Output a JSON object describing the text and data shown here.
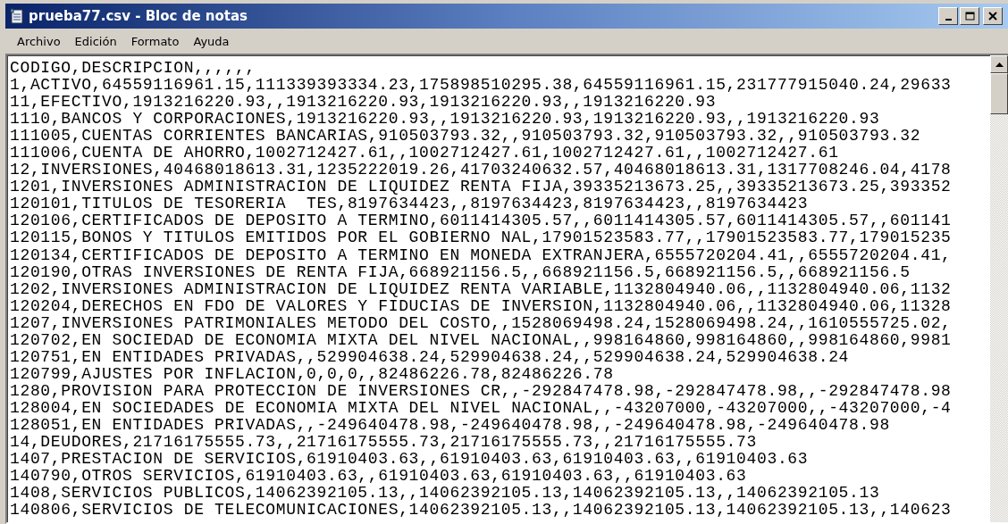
{
  "window": {
    "title": "prueba77.csv - Bloc de notas"
  },
  "menu": [
    "Archivo",
    "Edición",
    "Formato",
    "Ayuda"
  ],
  "lines": [
    "CODIGO,DESCRIPCION,,,,,,",
    "1,ACTIVO,64559116961.15,111339393334.23,175898510295.38,64559116961.15,231777915040.24,29633",
    "11,EFECTIVO,1913216220.93,,1913216220.93,1913216220.93,,1913216220.93",
    "1110,BANCOS Y CORPORACIONES,1913216220.93,,1913216220.93,1913216220.93,,1913216220.93",
    "111005,CUENTAS CORRIENTES BANCARIAS,910503793.32,,910503793.32,910503793.32,,910503793.32",
    "111006,CUENTA DE AHORRO,1002712427.61,,1002712427.61,1002712427.61,,1002712427.61",
    "12,INVERSIONES,40468018613.31,1235222019.26,41703240632.57,40468018613.31,1317708246.04,4178",
    "1201,INVERSIONES ADMINISTRACION DE LIQUIDEZ RENTA FIJA,39335213673.25,,39335213673.25,393352",
    "120101,TITULOS DE TESORERIA  TES,8197634423,,8197634423,8197634423,,8197634423",
    "120106,CERTIFICADOS DE DEPOSITO A TERMINO,6011414305.57,,6011414305.57,6011414305.57,,601141",
    "120115,BONOS Y TITULOS EMITIDOS POR EL GOBIERNO NAL,17901523583.77,,17901523583.77,179015235",
    "120134,CERTIFICADOS DE DEPOSITO A TERMINO EN MONEDA EXTRANJERA,6555720204.41,,6555720204.41,",
    "120190,OTRAS INVERSIONES DE RENTA FIJA,668921156.5,,668921156.5,668921156.5,,668921156.5",
    "1202,INVERSIONES ADMINISTRACION DE LIQUIDEZ RENTA VARIABLE,1132804940.06,,1132804940.06,1132",
    "120204,DERECHOS EN FDO DE VALORES Y FIDUCIAS DE INVERSION,1132804940.06,,1132804940.06,11328",
    "1207,INVERSIONES PATRIMONIALES METODO DEL COSTO,,1528069498.24,1528069498.24,,1610555725.02,",
    "120702,EN SOCIEDAD DE ECONOMIA MIXTA DEL NIVEL NACIONAL,,998164860,998164860,,998164860,9981",
    "120751,EN ENTIDADES PRIVADAS,,529904638.24,529904638.24,,529904638.24,529904638.24",
    "120799,AJUSTES POR INFLACION,0,0,0,,82486226.78,82486226.78",
    "1280,PROVISION PARA PROTECCION DE INVERSIONES CR,,-292847478.98,-292847478.98,,-292847478.98",
    "128004,EN SOCIEDADES DE ECONOMIA MIXTA DEL NIVEL NACIONAL,,-43207000,-43207000,,-43207000,-4",
    "128051,EN ENTIDADES PRIVADAS,,-249640478.98,-249640478.98,,-249640478.98,-249640478.98",
    "14,DEUDORES,21716175555.73,,21716175555.73,21716175555.73,,21716175555.73",
    "1407,PRESTACION DE SERVICIOS,61910403.63,,61910403.63,61910403.63,,61910403.63",
    "140790,OTROS SERVICIOS,61910403.63,,61910403.63,61910403.63,,61910403.63",
    "1408,SERVICIOS PUBLICOS,14062392105.13,,14062392105.13,14062392105.13,,14062392105.13",
    "140806,SERVICIOS DE TELECOMUNICACIONES,14062392105.13,,14062392105.13,14062392105.13,,140623"
  ]
}
